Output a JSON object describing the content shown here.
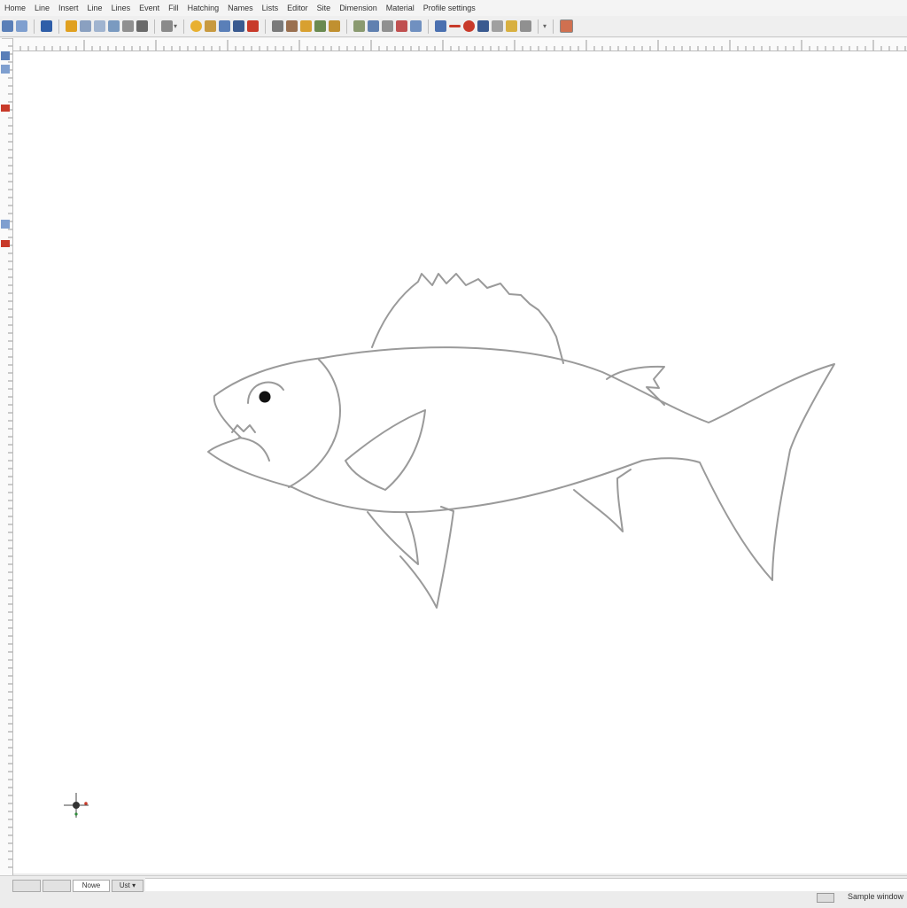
{
  "menu": {
    "items": [
      "Home",
      "Line",
      "Insert",
      "Line",
      "Lines",
      "Event",
      "Fill",
      "Hatching",
      "Names",
      "Lists",
      "Editor",
      "Site",
      "Dimension",
      "Material",
      "Profile settings"
    ]
  },
  "toolbar": {
    "icons": [
      "undo-icon",
      "redo-icon",
      "save-icon",
      "open-icon",
      "zoom-icon",
      "back-icon",
      "snap-icon",
      "settings-icon",
      "node-icon",
      "circle-icon",
      "rectangle-icon",
      "image-icon",
      "text-icon",
      "color-icon",
      "search-icon",
      "layer-icon",
      "pencil-icon",
      "grid-icon",
      "arrow-icon",
      "select-icon",
      "measure-icon",
      "print-icon",
      "export-icon",
      "zoom-tool-icon",
      "line-tool-icon",
      "record-icon",
      "palette-icon",
      "curve-icon",
      "brush-icon",
      "cursor-icon",
      "arrow-down-icon",
      "frame-icon"
    ]
  },
  "colors": {
    "accent_blue": "#2f5ea8",
    "accent_orange": "#e0a020",
    "accent_red": "#c83a2a",
    "outline": "#9a9a9a",
    "canvas": "#ffffff"
  },
  "statusbar": {
    "tab1": "",
    "tab2": "",
    "tab3": "Nowe",
    "tab4": "Ust",
    "right_text": "Sample window"
  }
}
